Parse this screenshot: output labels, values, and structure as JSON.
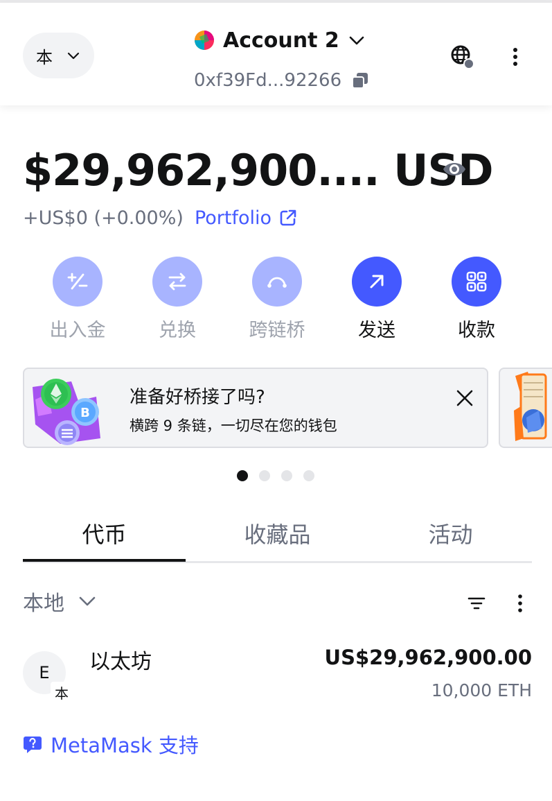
{
  "header": {
    "network_label": "本",
    "account_name": "Account 2",
    "address": "0xf39Fd...92266"
  },
  "balance": {
    "amount": "$29,962,900.... USD",
    "change": "+US$0 (+0.00%)",
    "portfolio_label": "Portfolio"
  },
  "actions": [
    {
      "label": "出入金",
      "enabled": false
    },
    {
      "label": "兑换",
      "enabled": false
    },
    {
      "label": "跨链桥",
      "enabled": false
    },
    {
      "label": "发送",
      "enabled": true
    },
    {
      "label": "收款",
      "enabled": true
    }
  ],
  "banner": {
    "title": "准备好桥接了吗?",
    "description": "横跨 9 条链，一切尽在您的钱包",
    "active_slide": 1,
    "slide_count": 4
  },
  "tabs": [
    {
      "label": "代币",
      "active": true
    },
    {
      "label": "收藏品",
      "active": false
    },
    {
      "label": "活动",
      "active": false
    }
  ],
  "filter": {
    "network_label": "本地"
  },
  "tokens": [
    {
      "avatar_letter": "E",
      "badge": "本",
      "name": "以太坊",
      "fiat_value": "US$29,962,900.00",
      "quantity": "10,000 ETH"
    }
  ],
  "support": {
    "label": "MetaMask 支持"
  },
  "colors": {
    "primary": "#4459ff",
    "primary_muted": "#a8b4ff",
    "text_default": "#121314",
    "text_alt": "#686e7d",
    "muted_bg": "#f2f3f5"
  }
}
